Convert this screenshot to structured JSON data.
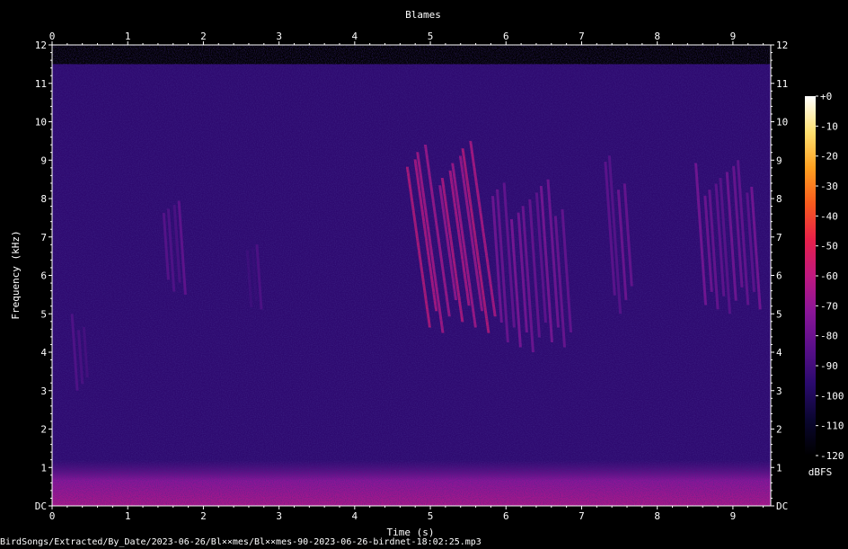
{
  "chart_data": {
    "type": "heatmap",
    "title": "Blames",
    "xlabel": "Time (s)",
    "ylabel": "Frequency (kHz)",
    "xlim": [
      0,
      9.5
    ],
    "ylim": [
      0,
      12
    ],
    "x_ticks": [
      "0",
      "1",
      "2",
      "3",
      "4",
      "5",
      "6",
      "7",
      "8",
      "9"
    ],
    "y_ticks": [
      "DC",
      "1",
      "2",
      "3",
      "4",
      "5",
      "6",
      "7",
      "8",
      "9",
      "10",
      "11",
      "12"
    ],
    "colorbar": {
      "label": "dBFS",
      "ticks": [
        "+0",
        "-10",
        "-20",
        "-30",
        "-40",
        "-50",
        "-60",
        "-70",
        "-80",
        "-90",
        "-100",
        "-110",
        "-120"
      ],
      "range": [
        -120,
        0
      ],
      "colors": [
        "#000000",
        "#0a0630",
        "#2a0a6e",
        "#5a0f8a",
        "#8a1598",
        "#c01880",
        "#e8204a",
        "#f85a1e",
        "#ffa020",
        "#ffe070",
        "#ffffff"
      ]
    },
    "background_level_dbfs": -95,
    "low_band": {
      "freq_khz": [
        0,
        1.2
      ],
      "level_dbfs": -72
    },
    "upper_cutoff_khz": 11.5,
    "events": [
      {
        "t": [
          0.3,
          0.5
        ],
        "f": [
          3,
          5
        ],
        "level_dbfs": -85
      },
      {
        "t": [
          1.5,
          1.8
        ],
        "f": [
          5.5,
          8.2
        ],
        "level_dbfs": -80
      },
      {
        "t": [
          2.6,
          2.8
        ],
        "f": [
          5,
          7
        ],
        "level_dbfs": -85
      },
      {
        "t": [
          4.95,
          5.9
        ],
        "f": [
          4.5,
          9.5
        ],
        "level_dbfs": -58
      },
      {
        "t": [
          5.9,
          6.9
        ],
        "f": [
          4,
          8.5
        ],
        "level_dbfs": -72
      },
      {
        "t": [
          7.4,
          7.7
        ],
        "f": [
          5,
          9.2
        ],
        "level_dbfs": -75
      },
      {
        "t": [
          8.6,
          9.4
        ],
        "f": [
          5,
          9
        ],
        "level_dbfs": -74
      }
    ]
  },
  "file_caption": "BirdSongs/Extracted/By_Date/2023-06-26/Bl××mes/Bl××mes-90-2023-06-26-birdnet-18:02:25.mp3",
  "colors": {
    "axis": "#ffffff",
    "background": "#000000"
  }
}
